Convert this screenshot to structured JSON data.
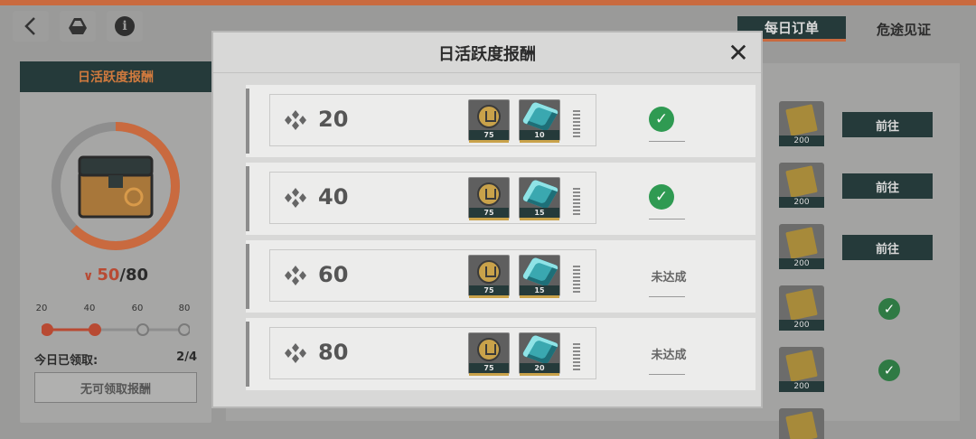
{
  "tabs": {
    "daily_orders": "每日订单",
    "perilous_witness": "危途见证"
  },
  "left_panel": {
    "header": "日活跃度报酬",
    "score_current": "50",
    "score_sep": "/80",
    "milestones": [
      "20",
      "40",
      "60",
      "80"
    ],
    "milestones_reached": 2,
    "claimed_label": "今日已领取:",
    "claimed_value": "2/4",
    "claim_button": "无可领取报酬"
  },
  "background_list": {
    "item_count": "200",
    "go_label": "前往",
    "rows": [
      "go",
      "go",
      "go",
      "done",
      "done",
      "none"
    ]
  },
  "modal": {
    "title": "日活跃度报酬",
    "rows": [
      {
        "level": "20",
        "items": [
          {
            "icon": "medal-icon",
            "qty": "75"
          },
          {
            "icon": "crystal-icon",
            "qty": "10"
          }
        ],
        "status": "done"
      },
      {
        "level": "40",
        "items": [
          {
            "icon": "medal-icon",
            "qty": "75"
          },
          {
            "icon": "crystal-icon",
            "qty": "15"
          }
        ],
        "status": "done"
      },
      {
        "level": "60",
        "items": [
          {
            "icon": "medal-icon",
            "qty": "75"
          },
          {
            "icon": "crystal-icon",
            "qty": "15"
          }
        ],
        "status": "未达成"
      },
      {
        "level": "80",
        "items": [
          {
            "icon": "medal-icon",
            "qty": "75"
          },
          {
            "icon": "crystal-icon",
            "qty": "20"
          }
        ],
        "status": "未达成"
      }
    ]
  },
  "colors": {
    "accent": "#c96a3f",
    "dark": "#253a3a",
    "check": "#2f9a52",
    "score": "#b84a33"
  }
}
